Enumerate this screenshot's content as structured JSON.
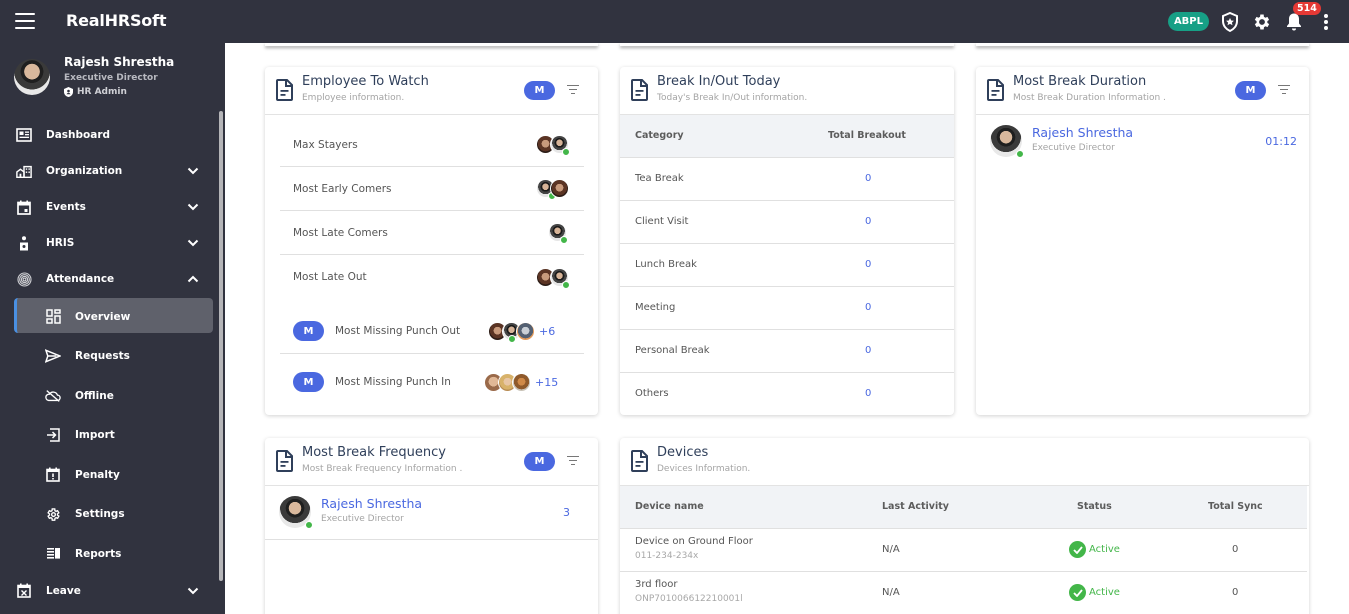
{
  "app": {
    "title": "RealHRSoft",
    "company_badge": "ABPL",
    "notification_count": "514"
  },
  "profile": {
    "name": "Rajesh Shrestha",
    "role": "Executive Director",
    "access": "HR Admin"
  },
  "sidebar": {
    "items": [
      {
        "label": "Dashboard",
        "icon": "dashboard-icon",
        "expandable": false
      },
      {
        "label": "Organization",
        "icon": "organization-icon",
        "expandable": true,
        "expanded": false
      },
      {
        "label": "Events",
        "icon": "calendar-icon",
        "expandable": true,
        "expanded": false
      },
      {
        "label": "HRIS",
        "icon": "person-icon",
        "expandable": true,
        "expanded": false
      },
      {
        "label": "Attendance",
        "icon": "fingerprint-icon",
        "expandable": true,
        "expanded": true
      }
    ],
    "attendance_sub": [
      {
        "label": "Overview",
        "icon": "overview-icon",
        "active": true
      },
      {
        "label": "Requests",
        "icon": "send-icon"
      },
      {
        "label": "Offline",
        "icon": "cloud-off-icon"
      },
      {
        "label": "Import",
        "icon": "import-icon"
      },
      {
        "label": "Penalty",
        "icon": "penalty-icon"
      },
      {
        "label": "Settings",
        "icon": "gear-icon"
      },
      {
        "label": "Reports",
        "icon": "reports-icon"
      }
    ],
    "leave": {
      "label": "Leave",
      "icon": "leave-calendar-icon",
      "expandable": true,
      "expanded": false
    }
  },
  "employee_to_watch": {
    "title": "Employee To Watch",
    "subtitle": "Employee information.",
    "pill": "M",
    "rows": [
      {
        "label": "Max Stayers"
      },
      {
        "label": "Most Early Comers"
      },
      {
        "label": "Most Late Comers"
      },
      {
        "label": "Most Late Out"
      },
      {
        "label": "Most Missing Punch Out",
        "pill": "M",
        "more": "+6"
      },
      {
        "label": "Most Missing Punch In",
        "pill": "M",
        "more": "+15"
      }
    ]
  },
  "break_today": {
    "title": "Break In/Out Today",
    "subtitle": "Today's Break In/Out information.",
    "columns": [
      "Category",
      "Total Breakout"
    ],
    "rows": [
      {
        "category": "Tea Break",
        "total": "0"
      },
      {
        "category": "Client Visit",
        "total": "0"
      },
      {
        "category": "Lunch Break",
        "total": "0"
      },
      {
        "category": "Meeting",
        "total": "0"
      },
      {
        "category": "Personal Break",
        "total": "0"
      },
      {
        "category": "Others",
        "total": "0"
      }
    ]
  },
  "most_break_duration": {
    "title": "Most Break Duration",
    "subtitle": "Most Break Duration Information .",
    "pill": "M",
    "person": {
      "name": "Rajesh Shrestha",
      "role": "Executive Director",
      "value": "01:12"
    }
  },
  "most_break_frequency": {
    "title": "Most Break Frequency",
    "subtitle": "Most Break Frequency Information .",
    "pill": "M",
    "person": {
      "name": "Rajesh Shrestha",
      "role": "Executive Director",
      "value": "3"
    }
  },
  "devices": {
    "title": "Devices",
    "subtitle": "Devices Information.",
    "columns": [
      "Device name",
      "Last Activity",
      "Status",
      "Total Sync"
    ],
    "rows": [
      {
        "name": "Device on Ground Floor",
        "id": "011-234-234x",
        "last_activity": "N/A",
        "status": "Active",
        "total_sync": "0"
      },
      {
        "name": "3rd floor",
        "id": "ONP701006612210001l",
        "last_activity": "N/A",
        "status": "Active",
        "total_sync": "0"
      }
    ]
  },
  "colors": {
    "topbar": "#31333f",
    "accent": "#4a68e0",
    "active_green": "#43b649",
    "badge_teal": "#17a086",
    "notification_red": "#e53935"
  }
}
